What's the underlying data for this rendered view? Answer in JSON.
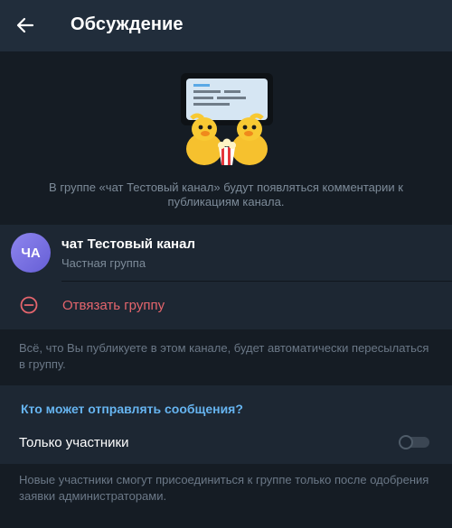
{
  "header": {
    "title": "Обсуждение"
  },
  "hero": {
    "description": "В группе «чат Тестовый канал» будут появляться комментарии к публикациям канала."
  },
  "group": {
    "avatar_initials": "ЧА",
    "name": "чат Тестовый канал",
    "type": "Частная группа",
    "unlink_label": "Отвязать группу"
  },
  "info_publish": "Всё, что Вы публикуете в этом канале, будет автоматически пересылаться в группу.",
  "who_can_send": {
    "header": "Кто может отправлять сообщения?",
    "members_only_label": "Только участники",
    "members_only_enabled": false
  },
  "info_approval": "Новые участники смогут присоединиться к группе только после одобрения заявки администраторами.",
  "colors": {
    "accent": "#66b4f0",
    "danger": "#e5656d",
    "avatar": "#7a72e6"
  }
}
